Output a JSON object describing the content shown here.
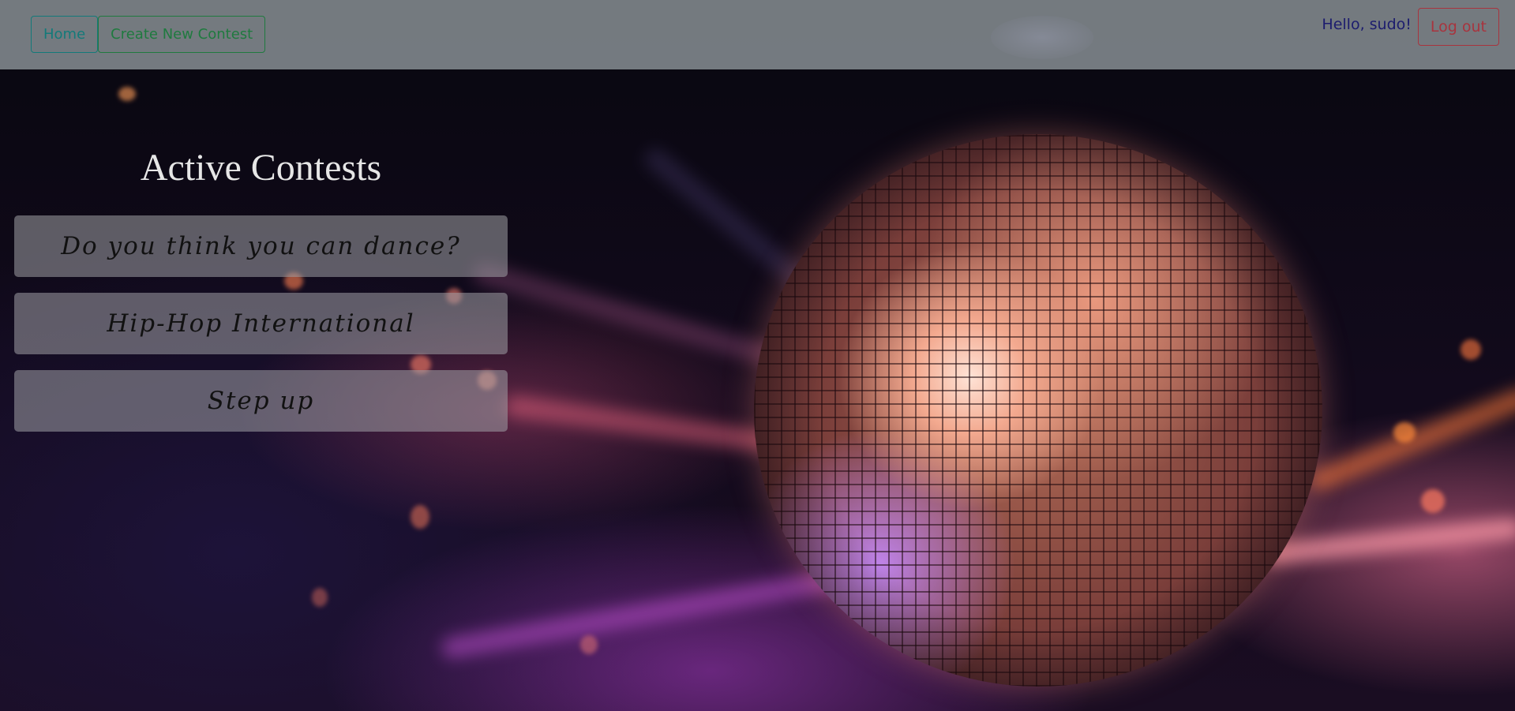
{
  "navbar": {
    "home_label": "Home",
    "create_label": "Create New Contest",
    "greeting": "Hello, sudo!",
    "logout_label": "Log out"
  },
  "main": {
    "title": "Active Contests",
    "contests": [
      {
        "name": "Do you think you can dance?"
      },
      {
        "name": "Hip-Hop International"
      },
      {
        "name": "Step up"
      }
    ]
  },
  "colors": {
    "navbar_bg": "#8c9498",
    "home_btn": "#137a7a",
    "create_btn": "#1f7a3f",
    "logout_btn": "#a8343e",
    "greeting_text": "#1c1c6e",
    "card_bg": "#a0a0a5"
  },
  "icons": {
    "background": "disco-ball-image"
  }
}
